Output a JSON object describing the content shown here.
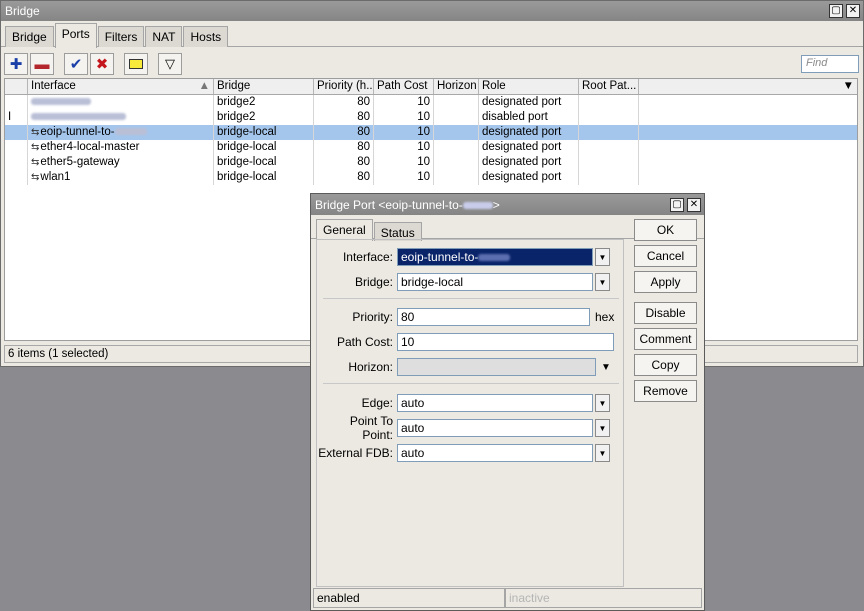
{
  "main": {
    "title": "Bridge",
    "tabs": [
      "Bridge",
      "Ports",
      "Filters",
      "NAT",
      "Hosts"
    ],
    "find_placeholder": "Find",
    "columns": [
      "Interface",
      "Bridge",
      "Priority (h...",
      "Path Cost",
      "Horizon",
      "Role",
      "Root Pat..."
    ],
    "rows": [
      {
        "flag": "",
        "interface": "",
        "bridge": "bridge2",
        "priority": "80",
        "path_cost": "10",
        "horizon": "",
        "role": "designated port"
      },
      {
        "flag": "I",
        "interface": "",
        "bridge": "bridge2",
        "priority": "80",
        "path_cost": "10",
        "horizon": "",
        "role": "disabled port"
      },
      {
        "flag": "",
        "interface": "eoip-tunnel-to-",
        "bridge": "bridge-local",
        "priority": "80",
        "path_cost": "10",
        "horizon": "",
        "role": "designated port"
      },
      {
        "flag": "",
        "interface": "ether4-local-master",
        "bridge": "bridge-local",
        "priority": "80",
        "path_cost": "10",
        "horizon": "",
        "role": "designated port"
      },
      {
        "flag": "",
        "interface": "ether5-gateway",
        "bridge": "bridge-local",
        "priority": "80",
        "path_cost": "10",
        "horizon": "",
        "role": "designated port"
      },
      {
        "flag": "",
        "interface": "wlan1",
        "bridge": "bridge-local",
        "priority": "80",
        "path_cost": "10",
        "horizon": "",
        "role": "designated port"
      }
    ],
    "status": "6 items (1 selected)"
  },
  "dialog": {
    "title": "Bridge Port <eoip-tunnel-to-",
    "title_end": ">",
    "tabs": [
      "General",
      "Status"
    ],
    "fields": {
      "interface_label": "Interface:",
      "interface_value": "eoip-tunnel-to-",
      "bridge_label": "Bridge:",
      "bridge_value": "bridge-local",
      "priority_label": "Priority:",
      "priority_value": "80",
      "priority_unit": "hex",
      "path_cost_label": "Path Cost:",
      "path_cost_value": "10",
      "horizon_label": "Horizon:",
      "horizon_value": "",
      "edge_label": "Edge:",
      "edge_value": "auto",
      "p2p_label": "Point To Point:",
      "p2p_value": "auto",
      "fdb_label": "External FDB:",
      "fdb_value": "auto"
    },
    "buttons": [
      "OK",
      "Cancel",
      "Apply",
      "Disable",
      "Comment",
      "Copy",
      "Remove"
    ],
    "status_left": "enabled",
    "status_right": "inactive"
  },
  "icons": {
    "window_restore": "restore-icon",
    "window_close": "close-icon"
  },
  "colors": {
    "selection": "#a5c6ec",
    "highlight_field": "#0a246a",
    "title_bar": "#8f8f8f",
    "desktop": "#8a8a8f"
  }
}
